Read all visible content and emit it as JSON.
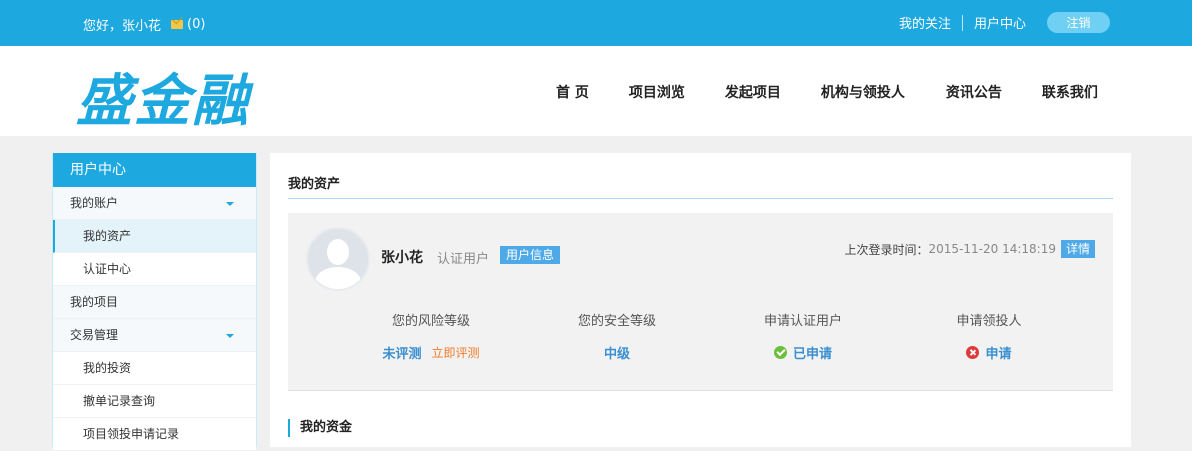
{
  "topbar": {
    "greeting": "您好，张小花",
    "message_count": "(0)",
    "links": [
      "我的关注",
      "用户中心"
    ],
    "logout_label": "注销"
  },
  "header": {
    "logo_text": "盛金融",
    "nav": [
      "首 页",
      "项目浏览",
      "发起项目",
      "机构与领投人",
      "资讯公告",
      "联系我们"
    ]
  },
  "sidebar": {
    "title": "用户中心",
    "items": [
      {
        "label": "我的账户"
      },
      {
        "label": "我的资产"
      },
      {
        "label": "认证中心"
      },
      {
        "label": "我的项目"
      },
      {
        "label": "交易管理"
      },
      {
        "label": "我的投资"
      },
      {
        "label": "撤单记录查询"
      },
      {
        "label": "项目领投申请记录"
      }
    ]
  },
  "main": {
    "title": "我的资产",
    "profile": {
      "name": "张小花",
      "user_type": "认证用户",
      "info_badge": "用户信息",
      "last_login_label": "上次登录时间：",
      "last_login_time": "2015-11-20 14:18:19",
      "detail_badge": "详情"
    },
    "stats": [
      {
        "label": "您的风险等级",
        "value": "未评测",
        "action": "立即评测"
      },
      {
        "label": "您的安全等级",
        "value": "中级"
      },
      {
        "label": "申请认证用户",
        "value": "已申请"
      },
      {
        "label": "申请领投人",
        "value": "申请"
      }
    ],
    "funds_title": "我的资金"
  },
  "colors": {
    "brand": "#1ea8e0",
    "link_blue": "#3a8fd0",
    "action_orange": "#f07a2a",
    "success_green": "#6cbf3c",
    "error_red": "#e0393c"
  },
  "icons": [
    "mail-icon",
    "avatar-placeholder-icon",
    "check-circle-icon",
    "close-circle-icon",
    "caret-down-icon"
  ]
}
